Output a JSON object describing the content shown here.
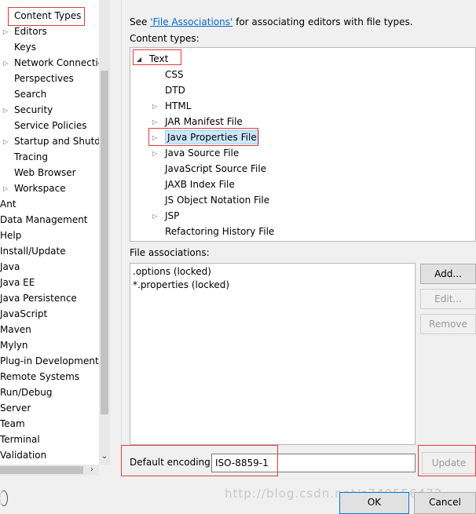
{
  "left_tree": {
    "items": [
      {
        "label": "Content Types",
        "indent": 1,
        "arrow": false
      },
      {
        "label": "Editors",
        "indent": 1,
        "arrow": true
      },
      {
        "label": "Keys",
        "indent": 1,
        "arrow": false
      },
      {
        "label": "Network Connectio",
        "indent": 1,
        "arrow": true
      },
      {
        "label": "Perspectives",
        "indent": 1,
        "arrow": false
      },
      {
        "label": "Search",
        "indent": 1,
        "arrow": false
      },
      {
        "label": "Security",
        "indent": 1,
        "arrow": true
      },
      {
        "label": "Service Policies",
        "indent": 1,
        "arrow": false
      },
      {
        "label": "Startup and Shutd",
        "indent": 1,
        "arrow": true
      },
      {
        "label": "Tracing",
        "indent": 1,
        "arrow": false
      },
      {
        "label": "Web Browser",
        "indent": 1,
        "arrow": false
      },
      {
        "label": "Workspace",
        "indent": 1,
        "arrow": true
      },
      {
        "label": "Ant",
        "indent": 0,
        "arrow": false
      },
      {
        "label": "Data Management",
        "indent": 0,
        "arrow": false
      },
      {
        "label": "Help",
        "indent": 0,
        "arrow": false
      },
      {
        "label": "Install/Update",
        "indent": 0,
        "arrow": false
      },
      {
        "label": "Java",
        "indent": 0,
        "arrow": false
      },
      {
        "label": "Java EE",
        "indent": 0,
        "arrow": false
      },
      {
        "label": "Java Persistence",
        "indent": 0,
        "arrow": false
      },
      {
        "label": "JavaScript",
        "indent": 0,
        "arrow": false
      },
      {
        "label": "Maven",
        "indent": 0,
        "arrow": false
      },
      {
        "label": "Mylyn",
        "indent": 0,
        "arrow": false
      },
      {
        "label": "Plug-in Development",
        "indent": 0,
        "arrow": false
      },
      {
        "label": "Remote Systems",
        "indent": 0,
        "arrow": false
      },
      {
        "label": "Run/Debug",
        "indent": 0,
        "arrow": false
      },
      {
        "label": "Server",
        "indent": 0,
        "arrow": false
      },
      {
        "label": "Team",
        "indent": 0,
        "arrow": false
      },
      {
        "label": "Terminal",
        "indent": 0,
        "arrow": false
      },
      {
        "label": "Validation",
        "indent": 0,
        "arrow": false
      }
    ]
  },
  "header": {
    "see_prefix": "See ",
    "file_assoc_link": "'File Associations'",
    "see_suffix": " for associating editors with file types."
  },
  "content_types": {
    "label": "Content types:",
    "items": [
      {
        "label": "Text",
        "level": 0,
        "arrow": "expanded"
      },
      {
        "label": "CSS",
        "level": 1,
        "arrow": "none"
      },
      {
        "label": "DTD",
        "level": 1,
        "arrow": "none"
      },
      {
        "label": "HTML",
        "level": 1,
        "arrow": "collapsed"
      },
      {
        "label": "JAR Manifest File",
        "level": 1,
        "arrow": "collapsed"
      },
      {
        "label": "Java Properties File",
        "level": 1,
        "arrow": "collapsed",
        "selected": true
      },
      {
        "label": "Java Source File",
        "level": 1,
        "arrow": "collapsed"
      },
      {
        "label": "JavaScript Source File",
        "level": 1,
        "arrow": "none"
      },
      {
        "label": "JAXB Index File",
        "level": 1,
        "arrow": "none"
      },
      {
        "label": "JS Object Notation File",
        "level": 1,
        "arrow": "none"
      },
      {
        "label": "JSP",
        "level": 1,
        "arrow": "collapsed"
      },
      {
        "label": "Refactoring History File",
        "level": 1,
        "arrow": "none"
      }
    ]
  },
  "file_associations": {
    "label": "File associations:",
    "items": [
      ".options (locked)",
      "*.properties (locked)"
    ],
    "add_button": "Add...",
    "edit_button": "Edit...",
    "remove_button": "Remove"
  },
  "encoding": {
    "label": "Default encoding:",
    "value": "ISO-8859-1",
    "update_button": "Update"
  },
  "footer": {
    "ok_button": "OK",
    "cancel_button": "Cancel",
    "watermark": "http://blog.csdn.net/s740556472"
  },
  "colors": {
    "annotation_red": "#e23b3b",
    "link_blue": "#0066cc",
    "selection": "#cce8ff"
  }
}
